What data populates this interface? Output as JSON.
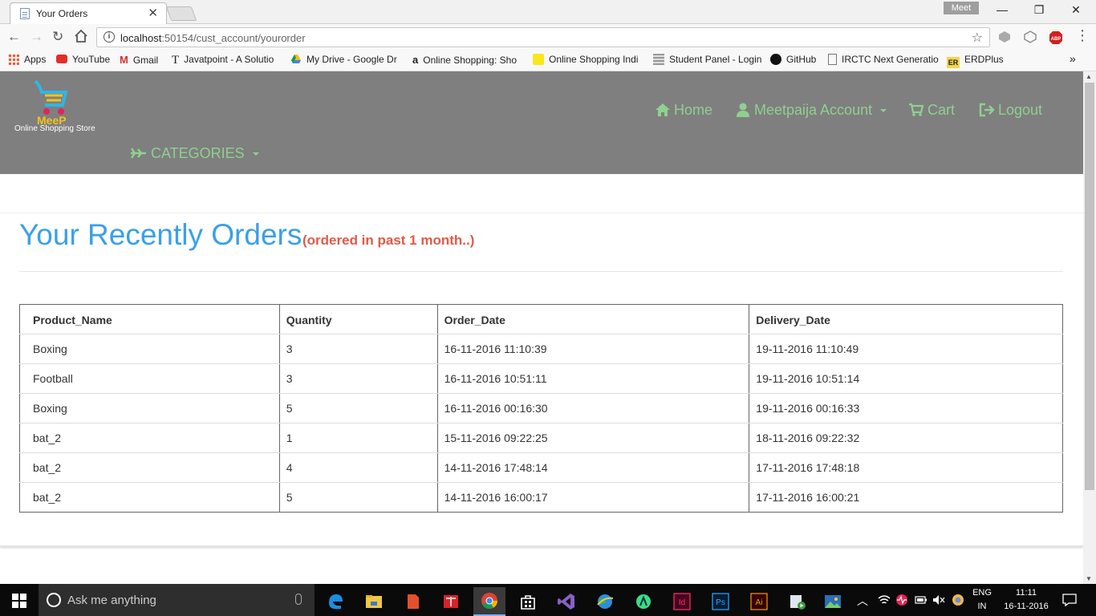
{
  "browser": {
    "tab_title": "Your Orders",
    "profile_name": "Meet",
    "url_host": "localhost",
    "url_path": ":50154/cust_account/yourorder",
    "bookmarks": [
      {
        "label": "Apps"
      },
      {
        "label": "YouTube"
      },
      {
        "label": "Gmail"
      },
      {
        "label": "Javatpoint - A Solutio"
      },
      {
        "label": "My Drive - Google Dr"
      },
      {
        "label": "Online Shopping: Sho"
      },
      {
        "label": "Online Shopping Indi"
      },
      {
        "label": "Student Panel - Login"
      },
      {
        "label": "GitHub"
      },
      {
        "label": "IRCTC Next Generatio"
      },
      {
        "label": "ERDPlus"
      }
    ],
    "bookmarks_overflow": "»",
    "abp_badge": "ABP",
    "er_badge": "ER"
  },
  "site": {
    "logo_text": "Online Shopping Store",
    "logo_mark": "MeeP",
    "nav": {
      "home": "Home",
      "account": "Meetpaija Account",
      "cart": "Cart",
      "logout": "Logout",
      "categories": "CATEGORIES"
    },
    "accent_color": "#8fd08f",
    "header_bg": "#7f7f7f"
  },
  "page": {
    "title": "Your Recently Orders",
    "subtitle": "(ordered in past 1 month..)",
    "title_color": "#3aa0e8",
    "subtitle_color": "#e25a47"
  },
  "orders": {
    "headers": [
      "Product_Name",
      "Quantity",
      "Order_Date",
      "Delivery_Date"
    ],
    "rows": [
      [
        "Boxing",
        "3",
        "16-11-2016 11:10:39",
        "19-11-2016 11:10:49"
      ],
      [
        "Football",
        "3",
        "16-11-2016 10:51:11",
        "19-11-2016 10:51:14"
      ],
      [
        "Boxing",
        "5",
        "16-11-2016 00:16:30",
        "19-11-2016 00:16:33"
      ],
      [
        "bat_2",
        "1",
        "15-11-2016 09:22:25",
        "18-11-2016 09:22:32"
      ],
      [
        "bat_2",
        "4",
        "14-11-2016 17:48:14",
        "17-11-2016 17:48:18"
      ],
      [
        "bat_2",
        "5",
        "14-11-2016 16:00:17",
        "17-11-2016 16:00:21"
      ]
    ]
  },
  "taskbar": {
    "search_placeholder": "Ask me anything",
    "lang": "ENG",
    "region": "IN",
    "time": "11:11",
    "date": "16-11-2016",
    "apps": [
      "edge-icon",
      "file-explorer-icon",
      "app-red-icon",
      "reader-icon",
      "chrome-icon",
      "store-icon",
      "visual-studio-icon",
      "globe-icon",
      "android-studio-icon",
      "indesign-icon",
      "photoshop-icon",
      "illustrator-icon",
      "media-icon",
      "photos-icon"
    ],
    "app_labels": {
      "indesign": "Id",
      "photoshop": "Ps",
      "illustrator": "Ai"
    }
  }
}
